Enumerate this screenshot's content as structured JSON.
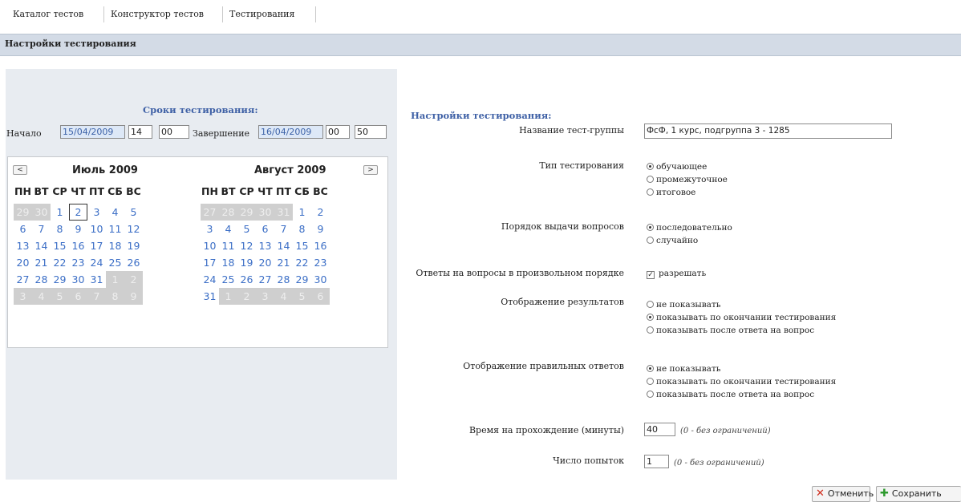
{
  "tabs": [
    {
      "label": "Каталог тестов"
    },
    {
      "label": "Конструктор тестов"
    },
    {
      "label": "Тестирования"
    }
  ],
  "header": {
    "title": "Настройки тестирования"
  },
  "left": {
    "title": "Сроки тестирования:",
    "start_label": "Начало",
    "start_date": "15/04/2009",
    "start_hour": "14",
    "start_min": "00",
    "end_label": "Завершение",
    "end_date": "16/04/2009",
    "end_hour": "00",
    "end_min": "50"
  },
  "calendar": {
    "prev_label": "<",
    "next_label": ">",
    "dow": [
      "ПН",
      "ВТ",
      "СР",
      "ЧТ",
      "ПТ",
      "СБ",
      "ВС"
    ],
    "months": [
      {
        "title": "Июль 2009",
        "days": [
          "29",
          "30",
          "1",
          "2",
          "3",
          "4",
          "5",
          "6",
          "7",
          "8",
          "9",
          "10",
          "11",
          "12",
          "13",
          "14",
          "15",
          "16",
          "17",
          "18",
          "19",
          "20",
          "21",
          "22",
          "23",
          "24",
          "25",
          "26",
          "27",
          "28",
          "29",
          "30",
          "31",
          "1",
          "2",
          "3",
          "4",
          "5",
          "6",
          "7",
          "8",
          "9"
        ],
        "other": [
          0,
          1,
          33,
          34,
          35,
          36,
          37,
          38,
          39,
          40,
          41
        ],
        "selected": 3
      },
      {
        "title": "Август 2009",
        "days": [
          "27",
          "28",
          "29",
          "30",
          "31",
          "1",
          "2",
          "3",
          "4",
          "5",
          "6",
          "7",
          "8",
          "9",
          "10",
          "11",
          "12",
          "13",
          "14",
          "15",
          "16",
          "17",
          "18",
          "19",
          "20",
          "21",
          "22",
          "23",
          "24",
          "25",
          "26",
          "27",
          "28",
          "29",
          "30",
          "31",
          "1",
          "2",
          "3",
          "4",
          "5",
          "6"
        ],
        "other": [
          0,
          1,
          2,
          3,
          4,
          36,
          37,
          38,
          39,
          40,
          41
        ],
        "selected": -1
      }
    ]
  },
  "right": {
    "title": "Настройки тестирования:",
    "group_label": "Название тест-группы",
    "group_value": "ФсФ, 1 курс, подгруппа 3 - 1285",
    "type_label": "Тип тестирования",
    "type_options": [
      "обучающее",
      "промежуточное",
      "итоговое"
    ],
    "type_selected": 0,
    "order_label": "Порядок выдачи вопросов",
    "order_options": [
      "последовательно",
      "случайно"
    ],
    "order_selected": 0,
    "anyorder_label": "Ответы на вопросы в произвольном порядке",
    "anyorder_option": "разрешать",
    "anyorder_checked": true,
    "results_label": "Отображение результатов",
    "results_options": [
      "не показывать",
      "показывать по окончании тестирования",
      "показывать после ответа на вопрос"
    ],
    "results_selected": 1,
    "correct_label": "Отображение правильных ответов",
    "correct_options": [
      "не показывать",
      "показывать по окончании тестирования",
      "показывать после ответа на вопрос"
    ],
    "correct_selected": 0,
    "time_label": "Время на прохождение (минуты)",
    "time_value": "40",
    "time_hint": "(0 - без ограничений)",
    "attempts_label": "Число попыток",
    "attempts_value": "1",
    "attempts_hint": "(0 - без ограничений)"
  },
  "buttons": {
    "cancel": "Отменить",
    "save": "Сохранить"
  },
  "colors": {
    "accent": "#3f61a6",
    "header_bg": "#d3dbe6",
    "panel_bg": "#e8ecf1",
    "cancel_icon": "#d02a1a",
    "save_icon": "#2e9a2e"
  }
}
